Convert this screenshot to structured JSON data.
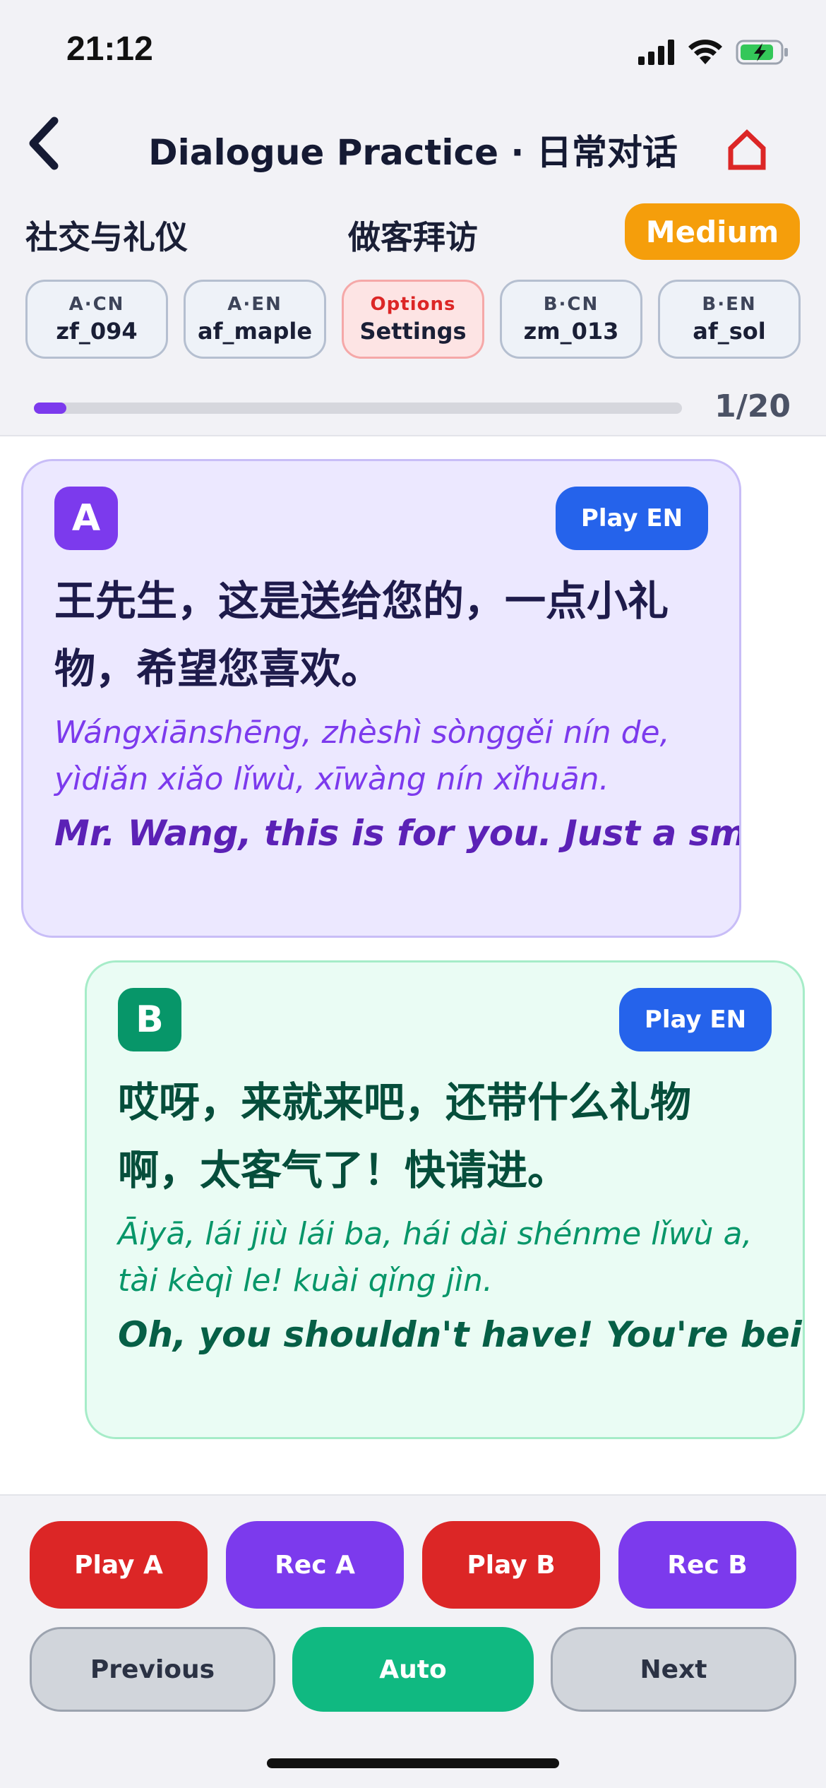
{
  "status_bar": {
    "time": "21:12"
  },
  "header": {
    "title": "Dialogue Practice · 日常对话",
    "category": "社交与礼仪",
    "topic": "做客拜访",
    "difficulty": "Medium"
  },
  "voices": [
    {
      "label": "A·CN",
      "value": "zf_094"
    },
    {
      "label": "A·EN",
      "value": "af_maple"
    },
    {
      "label": "Options",
      "value": "Settings"
    },
    {
      "label": "B·CN",
      "value": "zm_013"
    },
    {
      "label": "B·EN",
      "value": "af_sol"
    }
  ],
  "progress": {
    "current": 1,
    "total": 20,
    "text": "1/20"
  },
  "turns": [
    {
      "speaker": "A",
      "play_label": "Play EN",
      "hanzi": "王先生，这是送给您的，一点小礼物，希望您喜欢。",
      "pinyin": "Wángxiānshēng, zhèshì sònggěi nín de, yìdiǎn xiǎo lǐwù, xīwàng nín xǐhuān.",
      "english": "Mr. Wang, this is for you. Just a small gift, I h"
    },
    {
      "speaker": "B",
      "play_label": "Play EN",
      "hanzi": "哎呀，来就来吧，还带什么礼物啊，太客气了！快请进。",
      "pinyin": "Āiyā, lái jiù lái ba, hái dài shénme lǐwù a, tài kèqì le! kuài qǐng jìn.",
      "english": "Oh, you shouldn't have! You're being too"
    }
  ],
  "controls": {
    "play_a": "Play A",
    "rec_a": "Rec A",
    "play_b": "Play B",
    "rec_b": "Rec B",
    "previous": "Previous",
    "auto": "Auto",
    "next": "Next"
  },
  "colors": {
    "accent_purple": "#7c3aed",
    "accent_green": "#079669",
    "play_blue": "#2563eb",
    "record_red": "#dc2626",
    "difficulty_orange": "#f59e0b"
  }
}
